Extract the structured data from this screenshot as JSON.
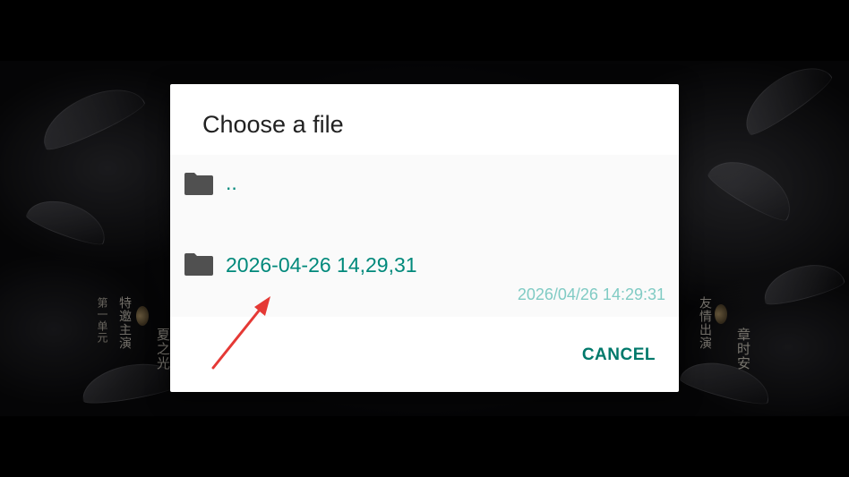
{
  "background": {
    "left_credit": {
      "col1": "第一单元",
      "col2": "特邀主演",
      "name": "夏之光"
    },
    "right_credit": {
      "col1": "友情出演",
      "name": "章时安"
    }
  },
  "dialog": {
    "title": "Choose a file",
    "files": [
      {
        "name": "..",
        "icon": "folder-icon",
        "date": ""
      },
      {
        "name": "2026-04-26 14,29,31",
        "icon": "folder-icon",
        "date": "2026/04/26 14:29:31"
      }
    ],
    "cancel_label": "CANCEL"
  },
  "colors": {
    "accent": "#00897b",
    "date_text": "#80cbc4",
    "folder_icon": "#505050",
    "annotation_arrow": "#e53935"
  }
}
